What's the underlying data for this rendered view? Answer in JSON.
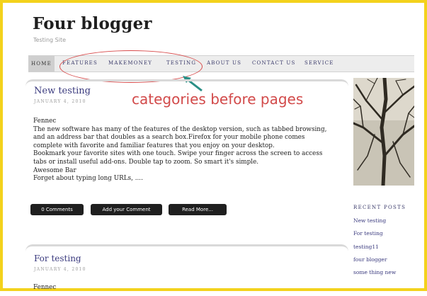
{
  "header": {
    "title": "Four blogger",
    "tagline": "Testing Site"
  },
  "nav": {
    "items": [
      "HOME",
      "FEATURES",
      "MAKEMONEY",
      "TESTING",
      "ABOUT US",
      "CONTACT US",
      "SERVICE"
    ]
  },
  "annotation": {
    "text": "categories before pages",
    "color": "#d24a4a"
  },
  "posts": [
    {
      "title": "New testing",
      "date": "JANUARY 4, 2010",
      "body": [
        "Fennec",
        "The new software has many of the features of the desktop version, such as tabbed browsing,",
        "and an address bar that doubles as a search box.Firefox for your mobile phone comes",
        "complete with favorite and familiar features that you enjoy on your desktop.",
        "Bookmark your favorite sites with one touch. Swipe your finger across the screen to access",
        "tabs or install useful add-ons. Double tap to zoom. So smart it's simple.",
        "Awesome Bar",
        "Forget about typing long URLs, ...."
      ],
      "buttons": [
        "0 Comments",
        "Add your Comment",
        "Read More..."
      ]
    },
    {
      "title": "For testing",
      "date": "JANUARY 4, 2010",
      "body_first": "Fennec"
    }
  ],
  "sidebar": {
    "recent_heading": "RECENT POSTS",
    "recent_posts": [
      "New testing",
      "For testing",
      "testing11",
      "four blogger",
      "some thing new"
    ]
  },
  "colors": {
    "frame": "#f3d21c",
    "link": "#3a3a7e",
    "button_bg": "#1f1f1f"
  }
}
